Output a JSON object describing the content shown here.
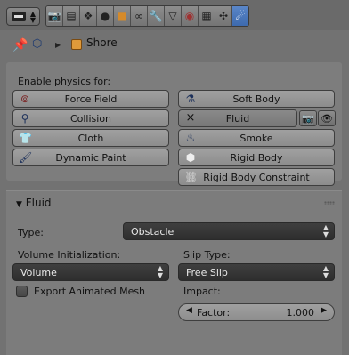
{
  "header": {
    "editor_icon": "properties-editor-icon",
    "tab_icons": [
      "render-icon",
      "render-layers-icon",
      "scene-icon",
      "world-icon",
      "object-icon",
      "constraints-icon",
      "modifiers-icon",
      "data-icon",
      "material-icon",
      "texture-icon",
      "particles-icon",
      "physics-icon"
    ],
    "active_tab": "physics-icon"
  },
  "breadcrumb": {
    "object_name": "Shore"
  },
  "enable_physics": {
    "label": "Enable physics for:",
    "left_buttons": [
      "Force Field",
      "Collision",
      "Cloth",
      "Dynamic Paint"
    ],
    "right_buttons": [
      "Soft Body",
      "Fluid",
      "Smoke",
      "Rigid Body",
      "Rigid Body Constraint"
    ],
    "fluid_remove_glyph": "×"
  },
  "fluid": {
    "title": "Fluid",
    "type_label": "Type:",
    "type_value": "Obstacle",
    "volume_init_label": "Volume Initialization:",
    "volume_init_value": "Volume",
    "slip_type_label": "Slip Type:",
    "slip_type_value": "Free Slip",
    "export_label": "Export Animated Mesh",
    "impact_label": "Impact:",
    "factor_label": "Factor:",
    "factor_value": "1.000"
  },
  "colors": {
    "background": "#727272",
    "active_tab": "#4d7bc0",
    "dropdown": "#333333",
    "object_icon": "#e09a3a"
  }
}
